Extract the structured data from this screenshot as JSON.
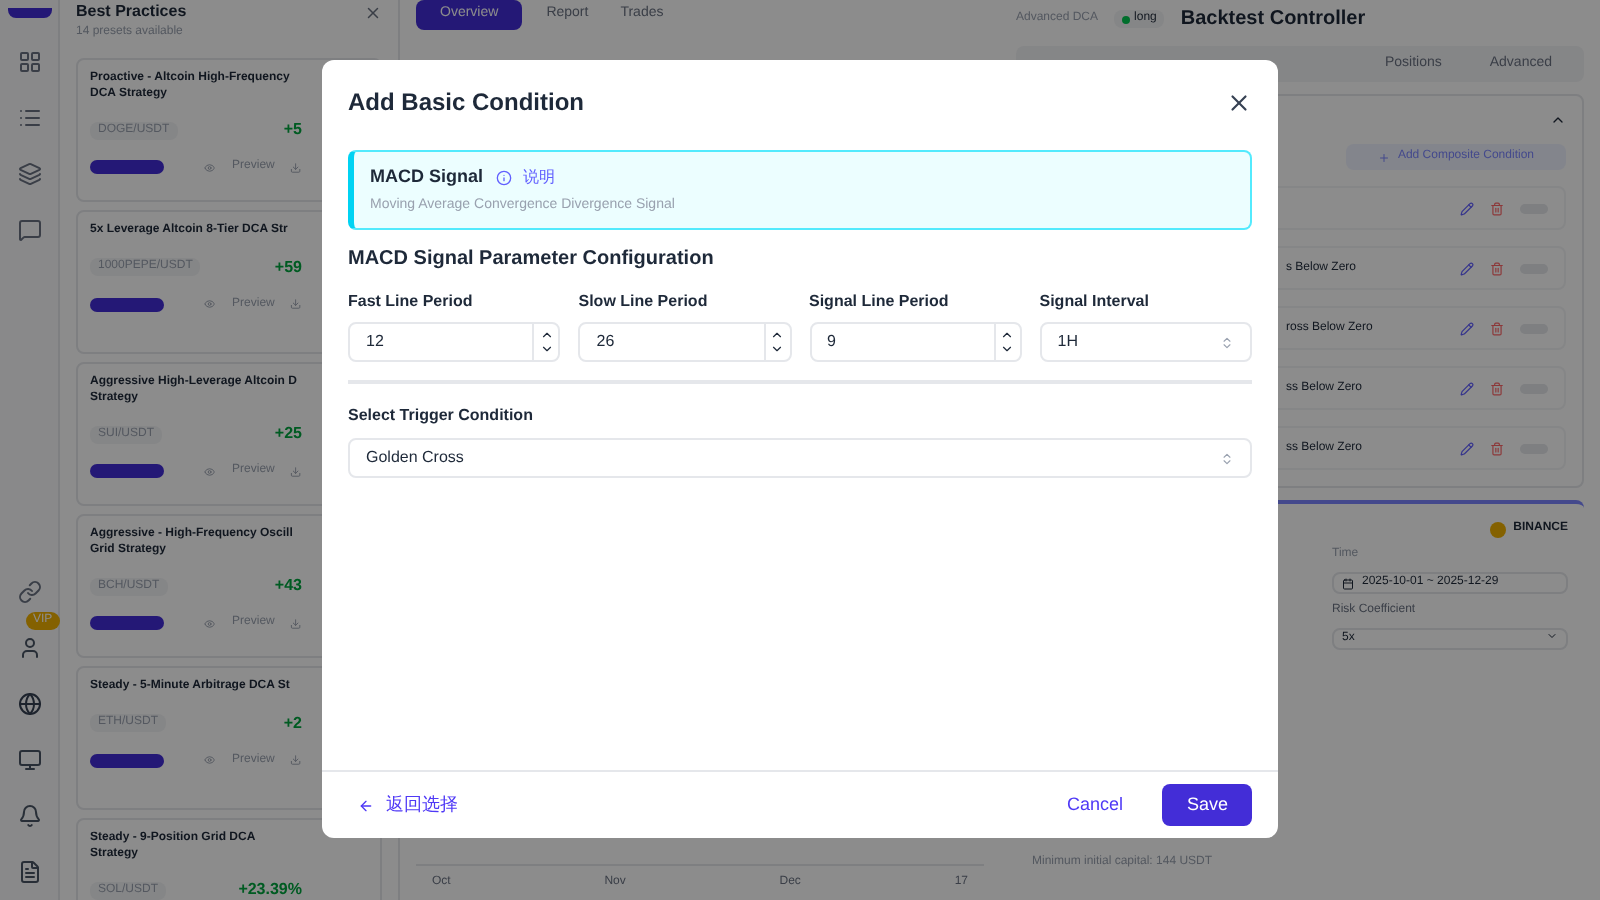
{
  "background": {
    "presets": {
      "title": "Best Practices",
      "subtitle": "14 presets available",
      "cards": [
        {
          "title": "Proactive - Altcoin High-Frequency DCA Strategy",
          "pair": "DOGE/USDT",
          "return": "+5",
          "preview": "Preview"
        },
        {
          "title": "5x Leverage Altcoin 8-Tier DCA Str",
          "pair": "1000PEPE/USDT",
          "return": "+59",
          "preview": "Preview"
        },
        {
          "title": "Aggressive High-Leverage Altcoin D Strategy",
          "pair": "SUI/USDT",
          "return": "+25",
          "preview": "Preview"
        },
        {
          "title": "Aggressive - High-Frequency Oscill Grid Strategy",
          "pair": "BCH/USDT",
          "return": "+43",
          "preview": "Preview"
        },
        {
          "title": "Steady - 5-Minute Arbitrage DCA St",
          "pair": "ETH/USDT",
          "return": "+2",
          "preview": "Preview"
        },
        {
          "title": "Steady - 9-Position Grid DCA Strategy",
          "pair": "SOL/USDT",
          "return": "+23.39%"
        }
      ]
    },
    "badge": "VIP",
    "main_tabs": [
      {
        "label": "Overview",
        "selected": true
      },
      {
        "label": "Report",
        "selected": false
      },
      {
        "label": "Trades",
        "selected": false
      }
    ],
    "chart_months": [
      "Oct",
      "Nov",
      "Dec",
      "17"
    ],
    "right": {
      "strategy": "Advanced DCA",
      "direction": "long",
      "title": "Backtest Controller",
      "tabs": [
        {
          "label": "Positions"
        },
        {
          "label": "Advanced"
        }
      ],
      "add_button": "Add Composite Condition",
      "conditions": [
        "s Below Zero",
        "ross Below Zero",
        "ss Below Zero",
        "ss Below Zero"
      ],
      "exchange": "BINANCE",
      "time_label": "Time",
      "time_value": "2025-10-01 ~ 2025-12-29",
      "risk_label": "Risk Coefficient",
      "risk_value": "5x",
      "min_capital": "Minimum initial capital: 144 USDT"
    }
  },
  "dialog": {
    "title": "Add Basic Condition",
    "signal": {
      "name": "MACD Signal",
      "help": "说明",
      "description": "Moving Average Convergence Divergence Signal"
    },
    "section_title": "MACD Signal Parameter Configuration",
    "fields": [
      {
        "kind": "number",
        "label": "Fast Line Period",
        "value": "12"
      },
      {
        "kind": "number",
        "label": "Slow Line Period",
        "value": "26"
      },
      {
        "kind": "number",
        "label": "Signal Line Period",
        "value": "9"
      },
      {
        "kind": "select",
        "label": "Signal Interval",
        "value": "1H"
      }
    ],
    "trigger": {
      "label": "Select Trigger Condition",
      "value": "Golden Cross"
    },
    "back": "返回选择",
    "cancel": "Cancel",
    "save": "Save"
  }
}
